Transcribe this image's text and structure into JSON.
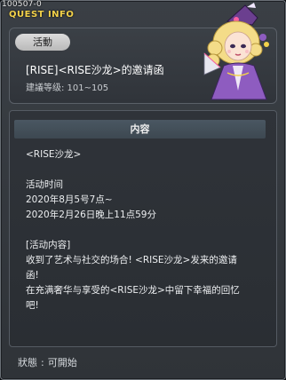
{
  "window": {
    "id": "100507-0",
    "title": "QUEST INFO"
  },
  "quest": {
    "category": "活動",
    "title": "[RISE]<RISE沙龙>的邀请函",
    "level": "建議等级: 101~105"
  },
  "content": {
    "tab_label": "内容",
    "lines": [
      "<RISE沙龙>",
      "",
      "活动时间",
      "2020年8月5号7点~",
      "2020年2月26日晚上11点59分",
      "",
      "[活动内容]",
      "收到了艺术与社交的场合! <RISE沙龙>发来的邀请",
      "函!",
      "在充满奢华与享受的<RISE沙龙>中留下幸福的回忆",
      "吧!"
    ]
  },
  "status": {
    "label": "狀態",
    "value": "可開始"
  },
  "npc": {
    "icon": "noblewoman-npc-icon"
  }
}
